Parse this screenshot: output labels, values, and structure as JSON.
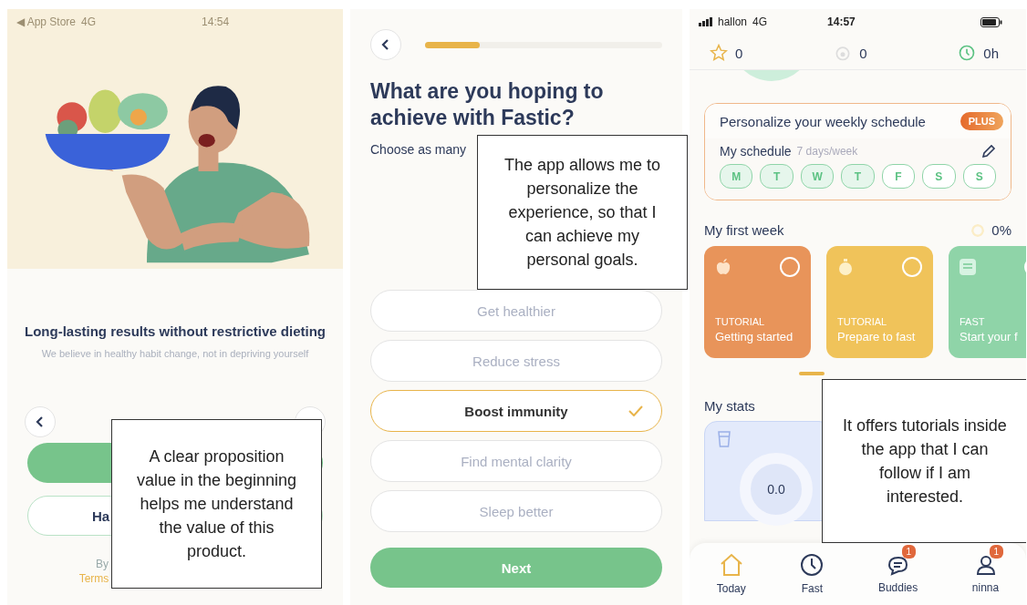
{
  "onboarding_screen": {
    "status_bar": {
      "carrier": "◀ App Store",
      "network": "4G",
      "time": "14:54"
    },
    "headline": "Long-lasting results without restrictive dieting",
    "subtitle": "We believe in healthy habit change, not in depriving yourself",
    "secondary_button": "Ha",
    "legal_text": "By",
    "legal_link": "Terms",
    "annotation": "A clear proposition value in the beginning helps me understand the value of this product."
  },
  "goals_screen": {
    "progress": {
      "level": 0.23
    },
    "title": "What are you hoping to achieve with Fastic?",
    "subtitle": "Choose as many",
    "options": [
      {
        "label": "Get healthier",
        "selected": false
      },
      {
        "label": "Reduce stress",
        "selected": false
      },
      {
        "label": "Boost immunity",
        "selected": true
      },
      {
        "label": "Find mental clarity",
        "selected": false
      },
      {
        "label": "Sleep better",
        "selected": false
      }
    ],
    "next_button": "Next",
    "annotation": "The app allows me to personalize the experience, so that I can achieve my personal goals."
  },
  "home_screen": {
    "status_bar": {
      "carrier": "hallon",
      "network": "4G",
      "time": "14:57"
    },
    "stats": [
      {
        "kind": "stars",
        "value": "0"
      },
      {
        "kind": "streak",
        "value": "0"
      },
      {
        "kind": "hours",
        "value": "0h"
      }
    ],
    "schedule": {
      "title": "Personalize your weekly schedule",
      "badge": "PLUS",
      "label": "My schedule",
      "frequency": "7 days/week",
      "days": [
        {
          "label": "M",
          "selected": true
        },
        {
          "label": "T",
          "selected": true
        },
        {
          "label": "W",
          "selected": true
        },
        {
          "label": "T",
          "selected": true
        },
        {
          "label": "F",
          "selected": false
        },
        {
          "label": "S",
          "selected": false
        },
        {
          "label": "S",
          "selected": false
        }
      ]
    },
    "first_week": {
      "title": "My first week",
      "progress": "0%",
      "level": 0
    },
    "cards": [
      {
        "category": "TUTORIAL",
        "title": "Getting started",
        "color": "#e8945a"
      },
      {
        "category": "TUTORIAL",
        "title": "Prepare to fast",
        "color": "#f0c35a"
      },
      {
        "category": "FAST",
        "title": "Start your f",
        "color": "#8fd4a8"
      }
    ],
    "my_stats": {
      "title": "My stats",
      "water": "0.0"
    },
    "nav": [
      {
        "label": "Today",
        "selected": true
      },
      {
        "label": "Fast",
        "selected": false
      },
      {
        "label": "Buddies",
        "selected": false,
        "badge": "1"
      },
      {
        "label": "ninna",
        "selected": false,
        "badge": "1"
      }
    ],
    "annotation": "It offers tutorials inside the app that I can follow if I am interested."
  }
}
